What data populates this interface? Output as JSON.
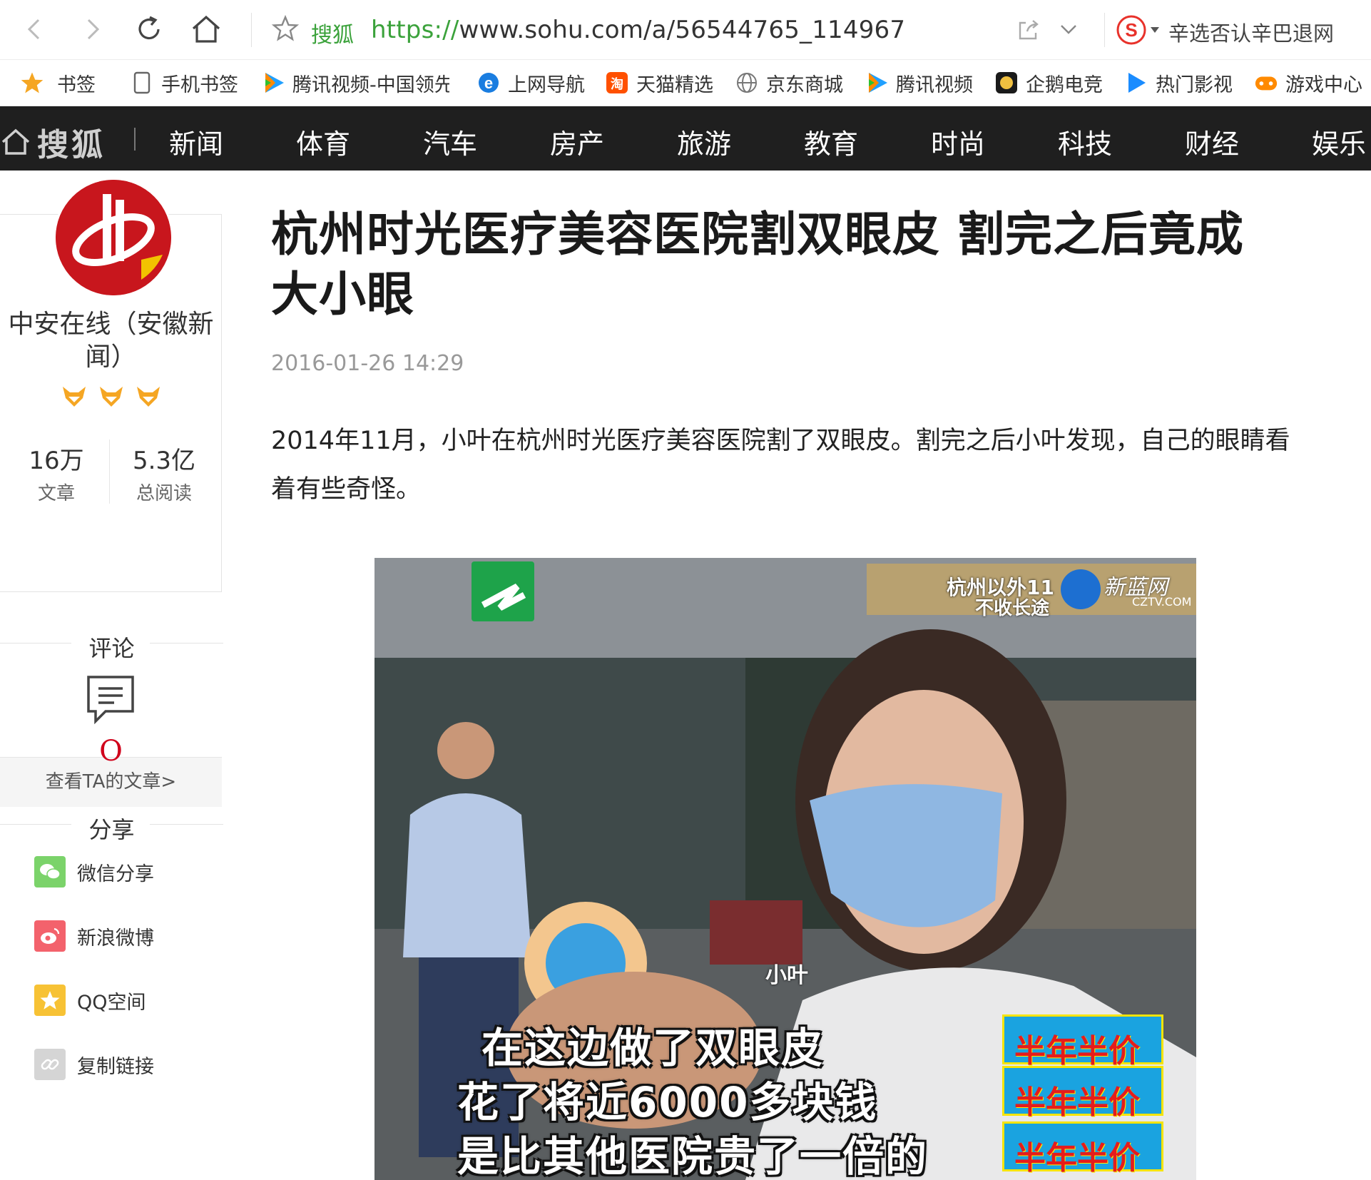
{
  "browser": {
    "site_name": "搜狐",
    "url_protocol": "https://",
    "url_rest": "www.sohu.com/a/56544765_114967",
    "search_suggest": "辛选否认辛巴退网"
  },
  "bookmarks": [
    {
      "label": "书签",
      "icon": "star-icon"
    },
    {
      "label": "手机书签",
      "icon": "phone-icon"
    },
    {
      "label": "腾讯视频-中国领先",
      "icon": "tencent-video-icon"
    },
    {
      "label": "上网导航",
      "icon": "ie-icon"
    },
    {
      "label": "天猫精选",
      "icon": "tmall-icon"
    },
    {
      "label": "京东商城",
      "icon": "globe-icon"
    },
    {
      "label": "腾讯视频",
      "icon": "tencent-video-icon"
    },
    {
      "label": "企鹅电竞",
      "icon": "penguin-icon"
    },
    {
      "label": "热门影视",
      "icon": "play-icon"
    },
    {
      "label": "游戏中心",
      "icon": "gamepad-icon"
    }
  ],
  "site_nav": {
    "logo": "搜狐",
    "items": [
      "新闻",
      "体育",
      "汽车",
      "房产",
      "旅游",
      "教育",
      "时尚",
      "科技",
      "财经",
      "娱乐"
    ]
  },
  "author": {
    "name": "中安在线（安徽新闻）",
    "articles_count": "16万",
    "articles_label": "文章",
    "reads_count": "5.3亿",
    "reads_label": "总阅读",
    "view_link": "查看TA的文章>"
  },
  "comments": {
    "title": "评论",
    "count": "O"
  },
  "share": {
    "title": "分享",
    "items": [
      "微信分享",
      "新浪微博",
      "QQ空间",
      "复制链接"
    ]
  },
  "article": {
    "title": "杭州时光医疗美容医院割双眼皮 割完之后竟成大小眼",
    "date": "2016-01-26 14:29",
    "paragraph": "2014年11月，小叶在杭州时光医疗美容医院割了双眼皮。割完之后小叶发现，自己的眼睛看着有些奇怪。"
  },
  "image": {
    "overlay_top": "杭州以外11",
    "overlay_top2": "不收长途",
    "channel_brand": "新蓝网",
    "channel_domain": "CZTV.COM",
    "caption_name": "小叶",
    "subtitles": [
      "在这边做了双眼皮",
      "花了将近6000多块钱",
      "是比其他医院贵了一倍的"
    ],
    "promo": "半年半价"
  },
  "colors": {
    "nav_bg": "#1f1f1f",
    "accent_green": "#3ba23b",
    "comment_red": "#d0021b"
  }
}
